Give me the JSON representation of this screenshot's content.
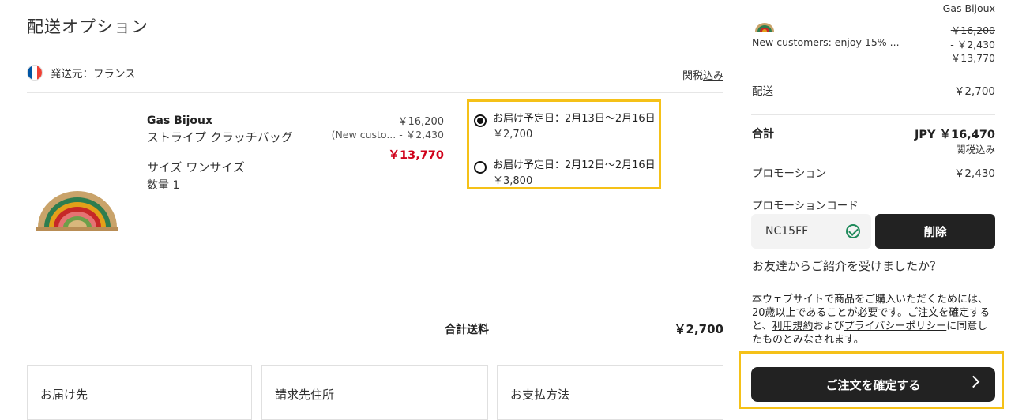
{
  "left": {
    "title": "配送オプション",
    "ship_from": "発送元：フランス",
    "tax_label_prefix": "関税",
    "tax_label_link": "込み",
    "item": {
      "brand": "Gas Bijoux",
      "name": "ストライプ クラッチバッグ",
      "size": "サイズ ワンサイズ",
      "qty": "数量 1",
      "price_original": "￥16,200",
      "price_promo": "(New custo... - ￥2,430",
      "price_final": "￥13,770"
    },
    "delivery_options": [
      {
        "label": "お届け予定日：2月13日～2月16日",
        "price": "￥2,700",
        "selected": true
      },
      {
        "label": "お届け予定日：2月12日～2月16日",
        "price": "￥3,800",
        "selected": false
      }
    ],
    "total_shipping_label": "合計送料",
    "total_shipping_value": "￥2,700",
    "cards": [
      "お届け先",
      "請求先住所",
      "お支払方法"
    ]
  },
  "right": {
    "brand": "Gas Bijoux",
    "promo_text": "New customers: enjoy 15% ...",
    "price_original": "￥16,200",
    "price_discount": "- ￥2,430",
    "price_final": "￥13,770",
    "shipping_label": "配送",
    "shipping_value": "￥2,700",
    "total_label": "合計",
    "total_value": "JPY ￥16,470",
    "total_tax": "関税込み",
    "promotion_label": "プロモーション",
    "promotion_value": "￥2,430",
    "promo_code_label": "プロモーションコード",
    "promo_code_value": "NC15FF",
    "delete_label": "削除",
    "referral_text": "お友達からご紹介を受けましたか？",
    "legal_1": "本ウェブサイトで商品をご購入いただくためには、20歳以上であることが必要です。ご注文を確定すると、",
    "legal_link_terms": "利用規約",
    "legal_2": "および",
    "legal_link_privacy": "プライバシーポリシー",
    "legal_3": "に同意したものとみなされます。",
    "confirm_label": "ご注文を確定する"
  },
  "colors": {
    "accent_highlight": "#f5c118",
    "price_red": "#d0021b",
    "button_dark": "#222222",
    "check_green": "#1f8a5b"
  },
  "icons": [
    "france-flag-icon",
    "radio-selected-icon",
    "radio-unselected-icon",
    "check-circle-icon",
    "chevron-right-icon"
  ]
}
